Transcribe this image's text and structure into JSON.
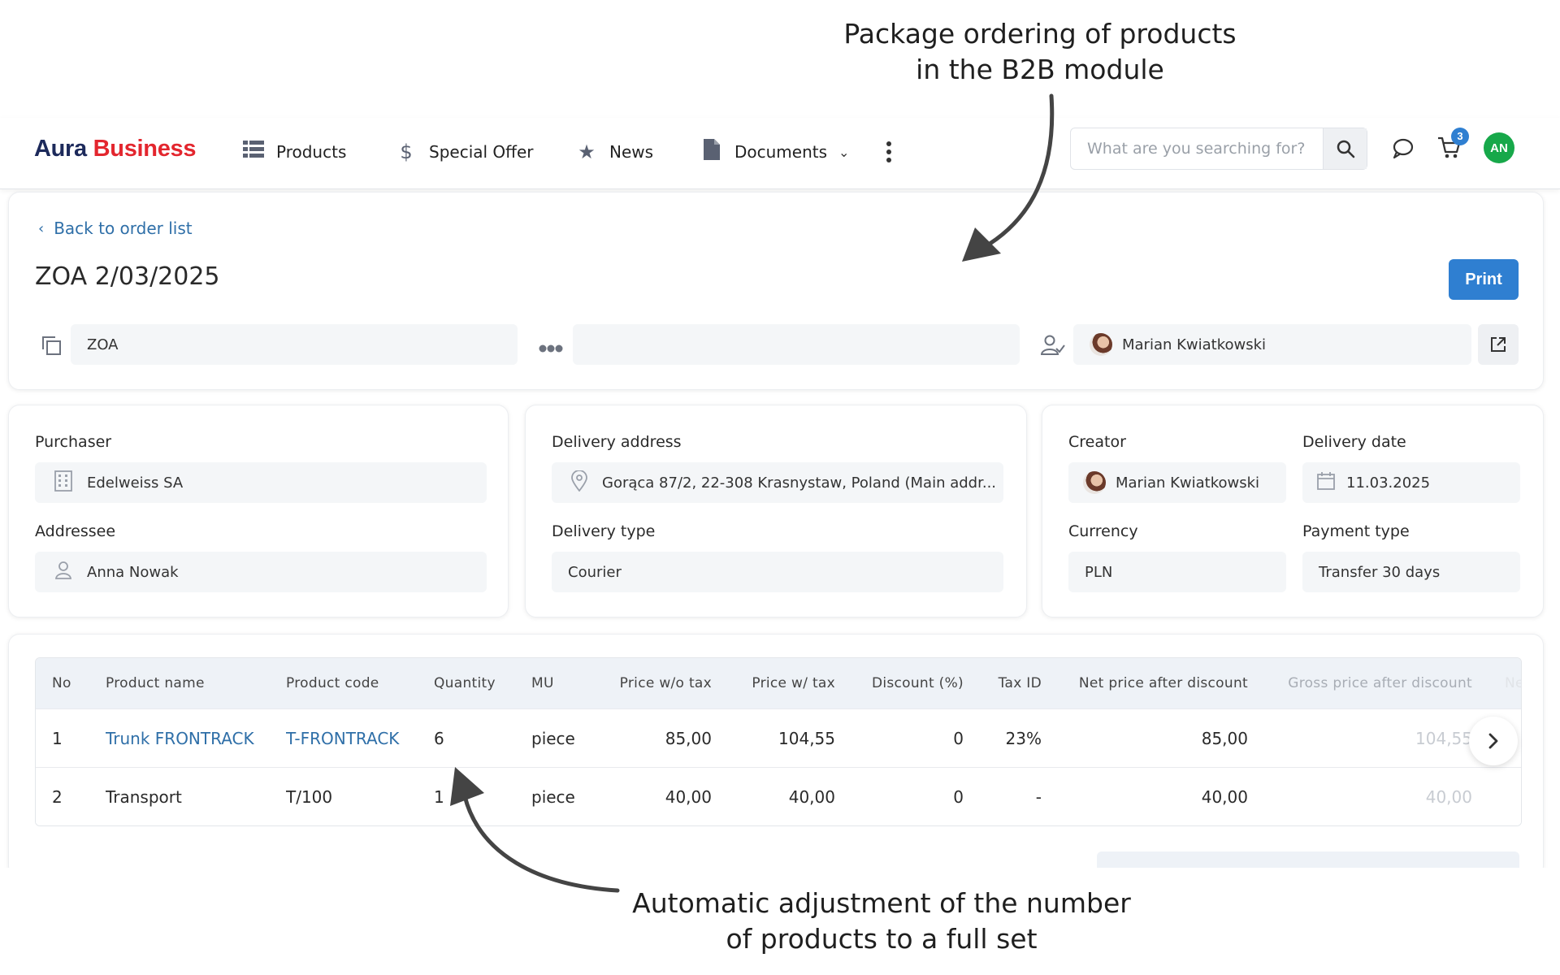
{
  "callouts": {
    "top_line1": "Package ordering of products",
    "top_line2": "in the B2B module",
    "bottom_line1": "Automatic adjustment of the number",
    "bottom_line2": "of products to a full set"
  },
  "brand": {
    "part1": "Aura",
    "part2": "Business"
  },
  "nav": {
    "products": "Products",
    "special_offer": "Special Offer",
    "news": "News",
    "documents": "Documents"
  },
  "search": {
    "placeholder": "What are you searching for?"
  },
  "cart": {
    "count": "3"
  },
  "user": {
    "initials": "AN"
  },
  "order": {
    "back_label": "Back to order list",
    "title": "ZOA 2/03/2025",
    "print_label": "Print",
    "series": "ZOA",
    "status": "",
    "handler": "Marian Kwiatkowski"
  },
  "purchaser": {
    "label": "Purchaser",
    "value": "Edelweiss SA"
  },
  "addressee": {
    "label": "Addressee",
    "value": "Anna Nowak"
  },
  "delivery_address": {
    "label": "Delivery address",
    "value": "Gorąca 87/2, 22-308 Krasnystaw, Poland (Main addr..."
  },
  "delivery_type": {
    "label": "Delivery type",
    "value": "Courier"
  },
  "creator": {
    "label": "Creator",
    "value": "Marian Kwiatkowski"
  },
  "delivery_date": {
    "label": "Delivery date",
    "value": "11.03.2025"
  },
  "currency": {
    "label": "Currency",
    "value": "PLN"
  },
  "payment_type": {
    "label": "Payment type",
    "value": "Transfer 30 days"
  },
  "table": {
    "headers": {
      "no": "No",
      "name": "Product name",
      "code": "Product code",
      "qty": "Quantity",
      "mu": "MU",
      "price_wo": "Price w/o tax",
      "price_w": "Price w/ tax",
      "discount": "Discount (%)",
      "tax": "Tax ID",
      "net": "Net price after discount",
      "gross": "Gross price after discount",
      "extra": "Ne"
    },
    "rows": [
      {
        "no": "1",
        "name": "Trunk FRONTRACK",
        "code": "T-FRONTRACK",
        "qty": "6",
        "mu": "piece",
        "price_wo": "85,00",
        "price_w": "104,55",
        "discount": "0",
        "tax": "23%",
        "net": "85,00",
        "gross": "104,55"
      },
      {
        "no": "2",
        "name": "Transport",
        "code": "T/100",
        "qty": "1",
        "mu": "piece",
        "price_wo": "40,00",
        "price_w": "40,00",
        "discount": "0",
        "tax": "-",
        "net": "40,00",
        "gross": "40,00"
      }
    ]
  },
  "colors": {
    "accent": "#2f7fd1",
    "brand_red": "#e3262e",
    "brand_navy": "#1d2a5b",
    "avatar_green": "#17a84a"
  }
}
